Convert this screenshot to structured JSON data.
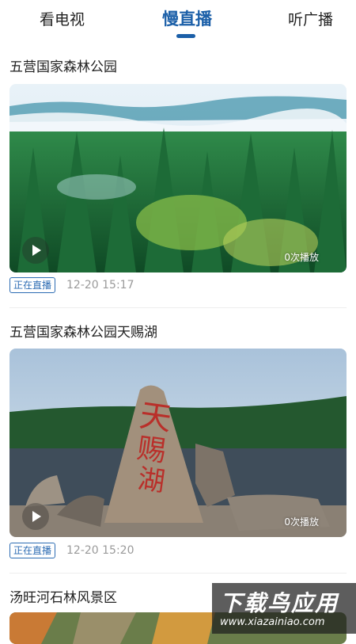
{
  "tabs": [
    {
      "label": "看电视"
    },
    {
      "label": "慢直播"
    },
    {
      "label": "听广播"
    }
  ],
  "items": [
    {
      "title": "五营国家森林公园",
      "badge": "正在直播",
      "time": "12-20 15:17",
      "views": "0次播放"
    },
    {
      "title": "五营国家森林公园天赐湖",
      "badge": "正在直播",
      "time": "12-20 15:20",
      "views": "0次播放"
    },
    {
      "title": "汤旺河石林风景区"
    }
  ],
  "watermark": {
    "main": "下载鸟应用",
    "url": "www.xiazainiao.com"
  },
  "colors": {
    "accent": "#1b5fa8",
    "badge": "#2d6cb3",
    "time": "#9a9a9a"
  },
  "icons": {
    "play": "play-icon"
  }
}
